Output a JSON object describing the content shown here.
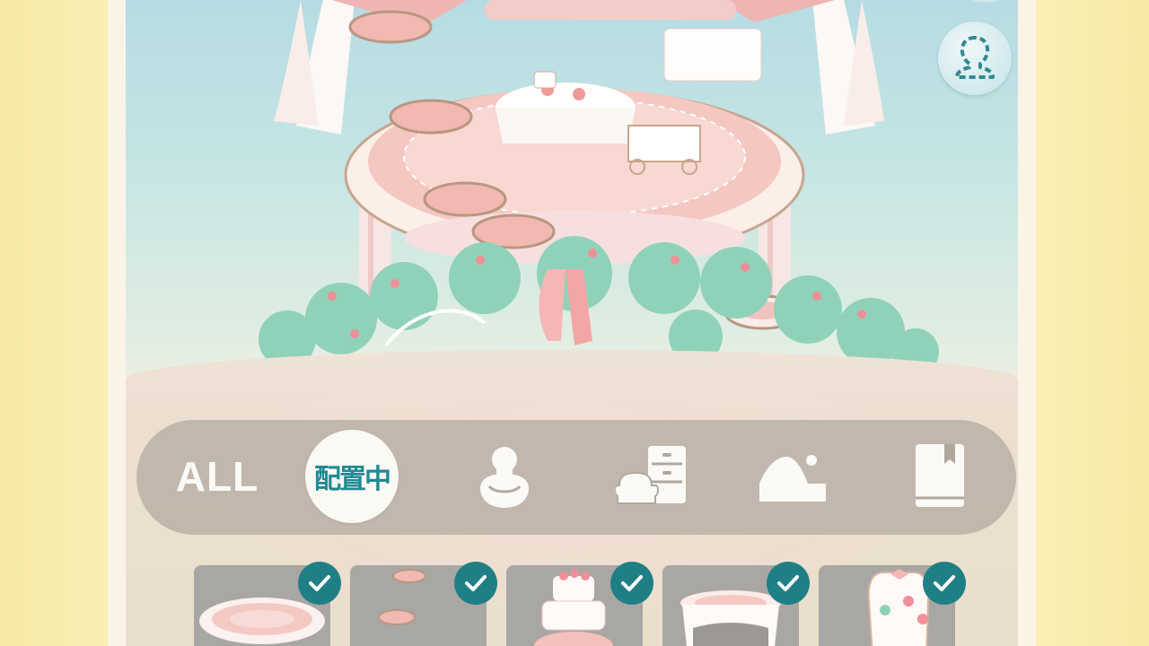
{
  "tabs": [
    {
      "id": "all",
      "label": "ALL",
      "icon": "",
      "selected": false
    },
    {
      "id": "placed",
      "label": "配置中",
      "icon": "",
      "selected": true
    },
    {
      "id": "character",
      "label": "",
      "icon": "character-icon",
      "selected": false
    },
    {
      "id": "furniture",
      "label": "",
      "icon": "furniture-icon",
      "selected": false
    },
    {
      "id": "landscape",
      "label": "",
      "icon": "landscape-icon",
      "selected": false
    },
    {
      "id": "book",
      "label": "",
      "icon": "book-icon",
      "selected": false
    }
  ],
  "avatar_button": {
    "icon": "avatar-outline-icon"
  },
  "items": [
    {
      "name": "rose-rug",
      "checked": true
    },
    {
      "name": "rose-stepping-stones",
      "checked": true
    },
    {
      "name": "rose-cake",
      "checked": true
    },
    {
      "name": "rose-table",
      "checked": true
    },
    {
      "name": "rose-chair",
      "checked": true
    }
  ],
  "colors": {
    "accent": "#1f7f85",
    "tabbar": "#b0a89e",
    "side_background": "#f8ecae",
    "item_background": "#a9a7a3"
  }
}
